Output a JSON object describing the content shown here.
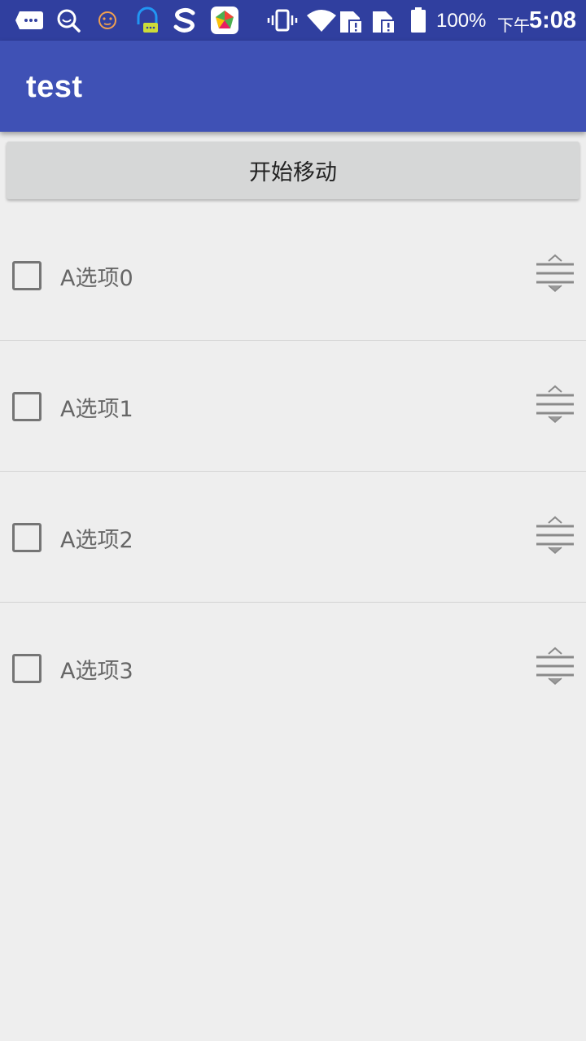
{
  "status_bar": {
    "battery_percent": "100%",
    "time_prefix": "下午",
    "time": "5:08"
  },
  "app_bar": {
    "title": "test"
  },
  "start_button": {
    "label": "开始移动"
  },
  "list": {
    "items": [
      {
        "label": "A选项0",
        "checked": false
      },
      {
        "label": "A选项1",
        "checked": false
      },
      {
        "label": "A选项2",
        "checked": false
      },
      {
        "label": "A选项3",
        "checked": false
      }
    ]
  },
  "colors": {
    "status_bar": "#303f9f",
    "app_bar": "#3f51b5",
    "background": "#eeeeee",
    "button": "#d6d7d7"
  }
}
